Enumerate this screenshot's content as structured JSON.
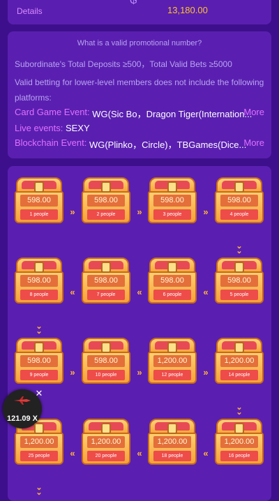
{
  "top": {
    "details_label": "Details",
    "amount": "13,180.00",
    "partial_glyph": "₲"
  },
  "info": {
    "title": "What is a valid promotional number?",
    "condition": "Subordinate's Total Deposits ≥500，Total Valid Bets ≥5000",
    "note_line1": "Valid betting for lower-level members does not include the following",
    "note_line2": "platforms:",
    "rows": [
      {
        "key": "Card Game Event: ",
        "value": "WG(Sic Bo，Dragon Tiger(Internation...",
        "more": "More"
      },
      {
        "key": "Live events: ",
        "value": "SEXY",
        "more": ""
      },
      {
        "key": "Blockchain Event: ",
        "value": "WG(Plinko，Circle)，TBGames(Dice...",
        "more": "More"
      }
    ]
  },
  "chests": [
    {
      "amount": "598.00",
      "people": "1 people"
    },
    {
      "amount": "598.00",
      "people": "2 people"
    },
    {
      "amount": "598.00",
      "people": "3 people"
    },
    {
      "amount": "598.00",
      "people": "4 people"
    },
    {
      "amount": "598.00",
      "people": "5 people"
    },
    {
      "amount": "598.00",
      "people": "6 people"
    },
    {
      "amount": "598.00",
      "people": "7 people"
    },
    {
      "amount": "598.00",
      "people": "8 people"
    },
    {
      "amount": "598.00",
      "people": "9 people"
    },
    {
      "amount": "598.00",
      "people": "10 people"
    },
    {
      "amount": "1,200.00",
      "people": "12 people"
    },
    {
      "amount": "1,200.00",
      "people": "14 people"
    },
    {
      "amount": "1,200.00",
      "people": "16 people"
    },
    {
      "amount": "1,200.00",
      "people": "18 people"
    },
    {
      "amount": "1,200.00",
      "people": "20 people"
    },
    {
      "amount": "1,200.00",
      "people": "25 people"
    }
  ],
  "icons": {
    "right": "»",
    "left": "«",
    "down": "⌄"
  },
  "widget": {
    "multiplier": "121.09 X",
    "close": "✕"
  },
  "colors": {
    "background": "#3e0f8c",
    "card": "#5a1fb0",
    "accent": "#e070ff",
    "gold": "#ffc12b"
  }
}
